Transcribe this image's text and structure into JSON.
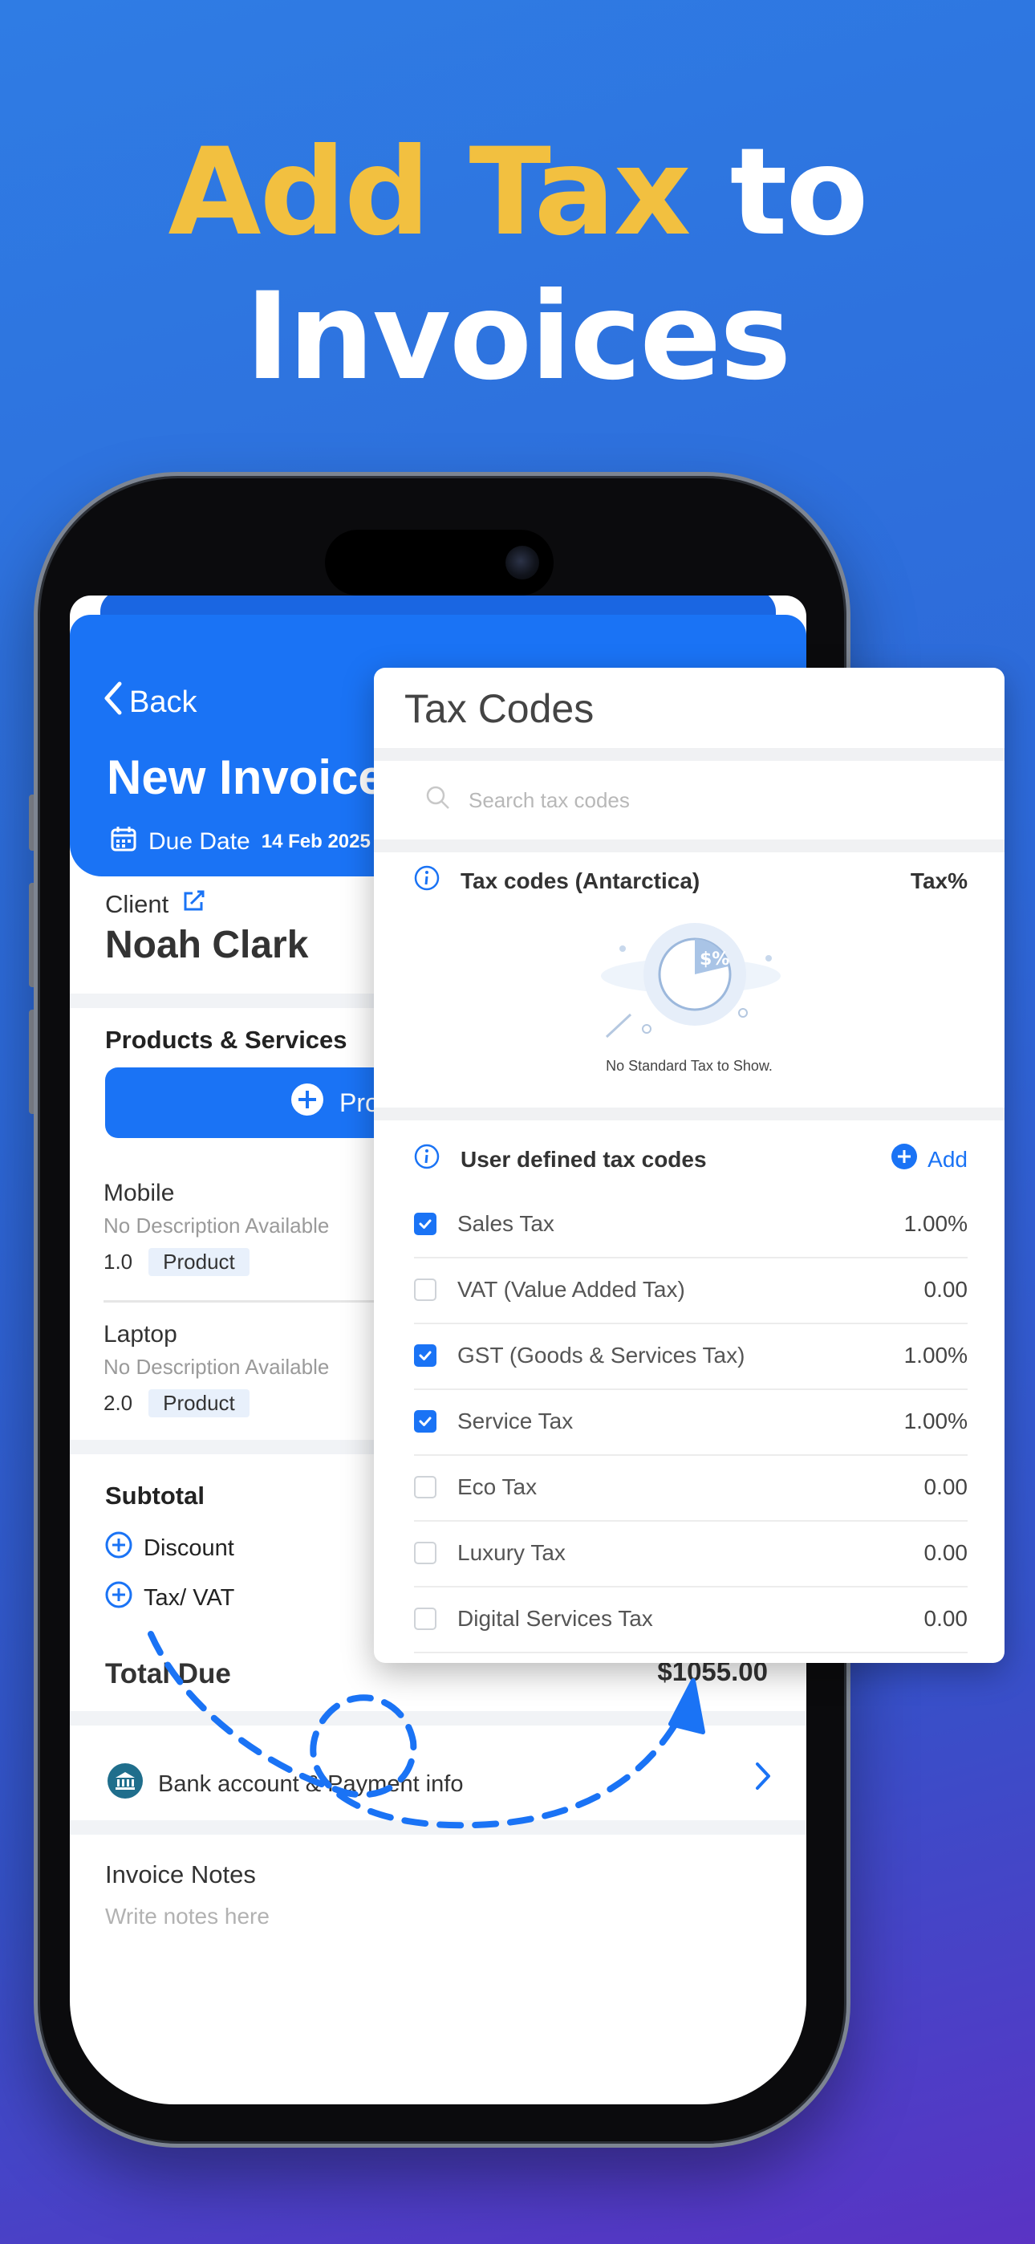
{
  "headline": {
    "accent": "Add Tax",
    "rest": " to",
    "line2": "Invoices"
  },
  "invoice": {
    "back_label": "Back",
    "title": "New Invoice",
    "due_label": "Due Date",
    "due_value": "14 Feb 2025",
    "client_label": "Client",
    "client_name": "Noah Clark",
    "products_title": "Products & Services",
    "add_product_label": "Pro",
    "items": [
      {
        "name": "Mobile",
        "desc": "No Description Available",
        "qty": "1.0",
        "type": "Product"
      },
      {
        "name": "Laptop",
        "desc": "No Description Available",
        "qty": "2.0",
        "type": "Product"
      }
    ],
    "subtotal_label": "Subtotal",
    "discount_label": "Discount",
    "tax_label": "Tax/ VAT",
    "total_label": "Total Due",
    "total_value": "$1055.00",
    "bank_label": "Bank account & Payment info",
    "notes_label": "Invoice Notes",
    "notes_placeholder": "Write notes here"
  },
  "tax_panel": {
    "title": "Tax Codes",
    "search_placeholder": "Search tax codes",
    "standard_heading": "Tax codes (Antarctica)",
    "percent_heading": "Tax%",
    "empty_text": "No Standard Tax to Show.",
    "user_heading": "User defined tax codes",
    "add_label": "Add",
    "codes": [
      {
        "name": "Sales Tax",
        "value": "1.00%",
        "checked": true
      },
      {
        "name": "VAT (Value Added Tax)",
        "value": "0.00",
        "checked": false
      },
      {
        "name": "GST (Goods & Services Tax)",
        "value": "1.00%",
        "checked": true
      },
      {
        "name": "Service Tax",
        "value": "1.00%",
        "checked": true
      },
      {
        "name": "Eco Tax",
        "value": "0.00",
        "checked": false
      },
      {
        "name": "Luxury Tax",
        "value": "0.00",
        "checked": false
      },
      {
        "name": "Digital Services Tax",
        "value": "0.00",
        "checked": false
      }
    ]
  },
  "colors": {
    "accent": "#f2c040",
    "primary": "#1a73f5",
    "background": "#2d68d8"
  }
}
